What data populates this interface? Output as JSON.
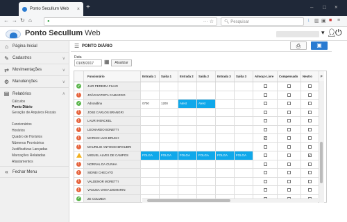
{
  "browser": {
    "tab_title": "Ponto Secullum Web",
    "url": "",
    "search_placeholder": "Pesquisar"
  },
  "app": {
    "title": "Ponto Secullum Web",
    "title_bold": "Ponto Secullum",
    "title_rest": " Web"
  },
  "sidebar": {
    "items": [
      {
        "label": "Página Inicial",
        "icon": "home-icon"
      },
      {
        "label": "Cadastros",
        "icon": "edit-icon"
      },
      {
        "label": "Movimentações",
        "icon": "exchange-icon"
      },
      {
        "label": "Manutenções",
        "icon": "gear-icon"
      },
      {
        "label": "Relatórios",
        "icon": "folder-icon"
      }
    ],
    "sub_items": [
      "Cálculos",
      "Ponto Diário",
      "Geração de Arquivos Fiscais",
      "Funcionários",
      "Horários",
      "Quadro de Horários",
      "Números Provisórios",
      "Justificativas Lançadas",
      "Marcações Relatadas",
      "Afastamentos"
    ],
    "active_sub": "Ponto Diário",
    "logout": "Fechar Menu"
  },
  "page": {
    "title": "PONTO DIÁRIO",
    "date_label": "Data",
    "date_value": "01/05/2017",
    "update_button": "Atualizar"
  },
  "grid": {
    "columns": [
      "Funcionário",
      "Entrada 1",
      "Saída 1",
      "Entrada 2",
      "Saída 2",
      "Entrada 3",
      "Saída 3",
      "Almoço Livre",
      "Compensado",
      "Neutro",
      "F"
    ],
    "rows": [
      {
        "status": "ok",
        "name": "JAIR PEREIRA FILHO",
        "e1": "",
        "s1": "",
        "e2": "",
        "s2": "",
        "e3": "",
        "s3": "",
        "almoco": false,
        "comp": false,
        "neutro": false,
        "blue": false
      },
      {
        "status": "err",
        "name": "JOÃO BATISTA CAMARGO",
        "e1": "",
        "s1": "",
        "e2": "",
        "s2": "",
        "e3": "",
        "s3": "",
        "almoco": false,
        "comp": false,
        "neutro": false,
        "blue": false
      },
      {
        "status": "ok",
        "name": "Adroaldina",
        "e1": "0700",
        "s1": "1200",
        "e2": "Atest",
        "s2": "Atest",
        "e3": "",
        "s3": "",
        "almoco": false,
        "comp": false,
        "neutro": false,
        "blue": false,
        "blue_e2": true
      },
      {
        "status": "err",
        "name": "JOSE CARLOS BRANGRI",
        "e1": "",
        "s1": "",
        "e2": "",
        "s2": "",
        "e3": "",
        "s3": "",
        "almoco": false,
        "comp": false,
        "neutro": false,
        "blue": false
      },
      {
        "status": "err",
        "name": "LAURI HENCKEL",
        "e1": "",
        "s1": "",
        "e2": "",
        "s2": "",
        "e3": "",
        "s3": "",
        "almoco": false,
        "comp": false,
        "neutro": false,
        "blue": false
      },
      {
        "status": "err",
        "name": "LEONARDO BONETTI",
        "e1": "",
        "s1": "",
        "e2": "",
        "s2": "",
        "e3": "",
        "s3": "",
        "almoco": false,
        "comp": false,
        "neutro": false,
        "blue": false
      },
      {
        "status": "err",
        "name": "MARCIO LUIS BRUCH",
        "e1": "",
        "s1": "",
        "e2": "",
        "s2": "",
        "e3": "",
        "s3": "",
        "almoco": true,
        "comp": false,
        "neutro": false,
        "blue": false
      },
      {
        "status": "err",
        "name": "MAURILIO ANTONIO BRHUBRI",
        "e1": "",
        "s1": "",
        "e2": "",
        "s2": "",
        "e3": "",
        "s3": "",
        "almoco": false,
        "comp": false,
        "neutro": false,
        "blue": false
      },
      {
        "status": "warn",
        "name": "MIGUEL ALVES DE CAMPOS",
        "e1": "FOLGA",
        "s1": "FOLGA",
        "e2": "FOLGA",
        "s2": "FOLGA",
        "e3": "FOLGA",
        "s3": "FOLGA",
        "almoco": false,
        "comp": false,
        "neutro": true,
        "blue": true
      },
      {
        "status": "err",
        "name": "NORIVAL DA CUNHA",
        "e1": "",
        "s1": "",
        "e2": "",
        "s2": "",
        "e3": "",
        "s3": "",
        "almoco": false,
        "comp": false,
        "neutro": false,
        "blue": false
      },
      {
        "status": "err",
        "name": "SIDNEI CHECATO",
        "e1": "",
        "s1": "",
        "e2": "",
        "s2": "",
        "e3": "",
        "s3": "",
        "almoco": false,
        "comp": false,
        "neutro": false,
        "blue": false
      },
      {
        "status": "err",
        "name": "VALDENOR MORETTI",
        "e1": "",
        "s1": "",
        "e2": "",
        "s2": "",
        "e3": "",
        "s3": "",
        "almoco": false,
        "comp": false,
        "neutro": false,
        "blue": false
      },
      {
        "status": "err",
        "name": "VANUSA VANIA DIOMARIN",
        "e1": "",
        "s1": "",
        "e2": "",
        "s2": "",
        "e3": "",
        "s3": "",
        "almoco": false,
        "comp": false,
        "neutro": false,
        "blue": false
      },
      {
        "status": "ok",
        "name": "ZE COLMEIA",
        "e1": "",
        "s1": "",
        "e2": "",
        "s2": "",
        "e3": "",
        "s3": "",
        "almoco": false,
        "comp": false,
        "neutro": false,
        "blue": false
      }
    ]
  },
  "colors": {
    "accent": "#2a7bd1",
    "ok": "#5ab54b",
    "error": "#e6653f",
    "warn": "#f2b01e",
    "highlight": "#10a8ea"
  }
}
